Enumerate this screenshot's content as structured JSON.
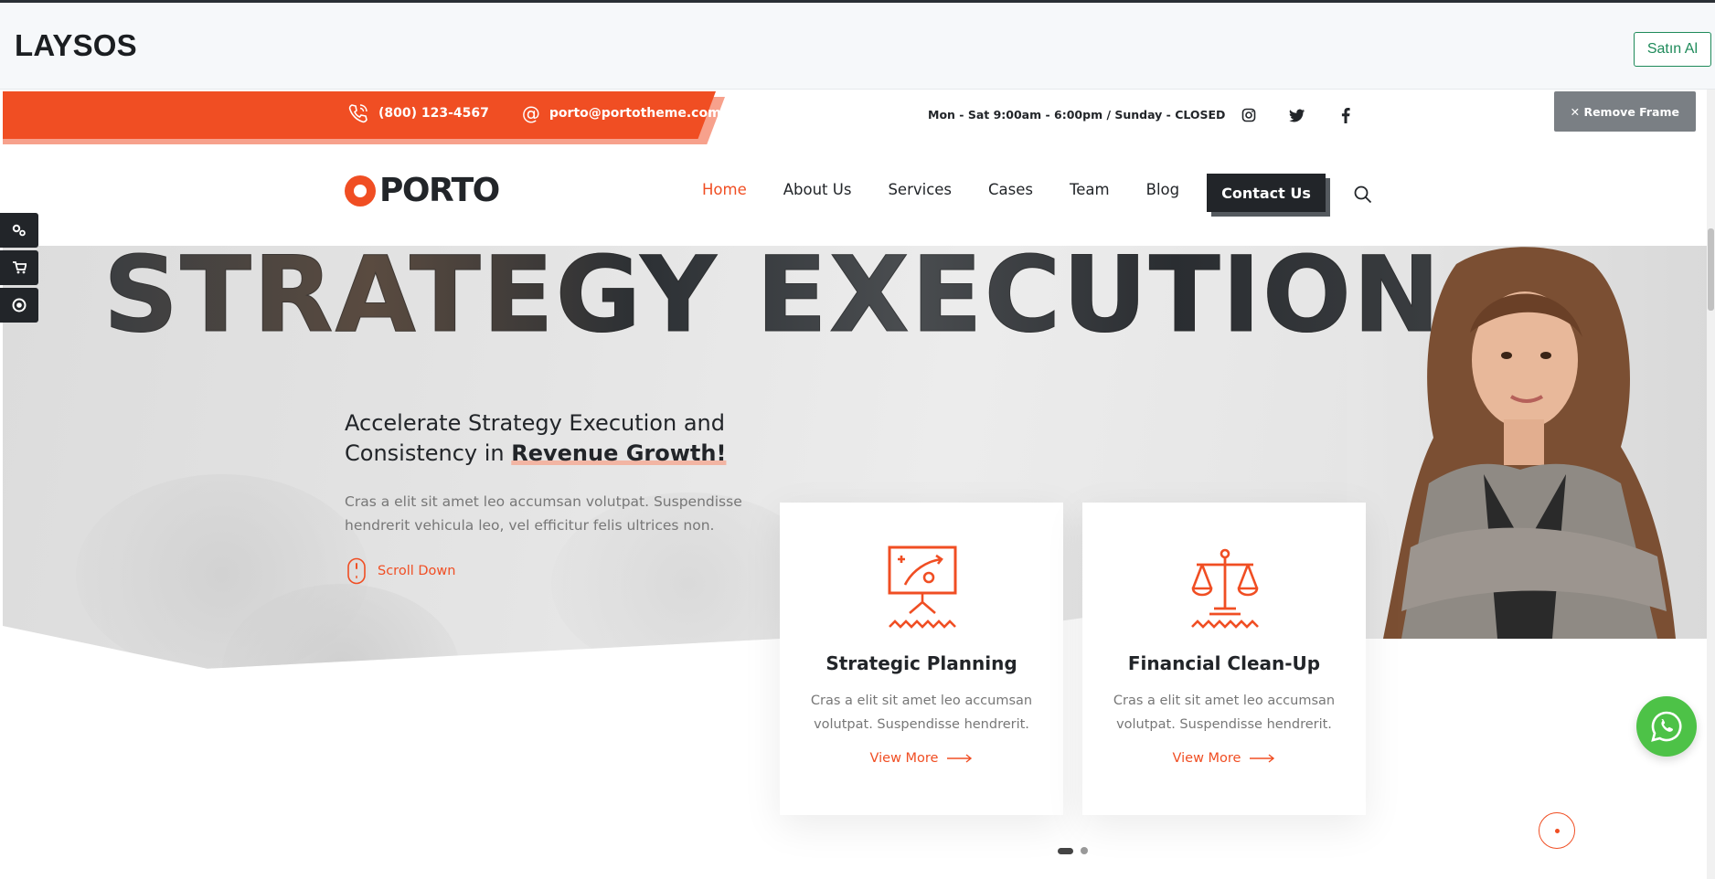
{
  "frame": {
    "title": "LAYSOS",
    "buy_label": "Satın Al",
    "remove_frame_label": "✕ Remove Frame"
  },
  "topbar": {
    "phone": "(800) 123-4567",
    "email": "porto@portotheme.com",
    "hours": "Mon - Sat 9:00am - 6:00pm / Sunday - CLOSED",
    "socials": [
      "instagram-icon",
      "twitter-icon",
      "facebook-icon"
    ]
  },
  "header": {
    "logo_text": "PORTO",
    "nav": [
      "Home",
      "About Us",
      "Services",
      "Cases",
      "Team",
      "Blog"
    ],
    "active_nav": "Home",
    "contact_label": "Contact Us"
  },
  "hero": {
    "big_title": "STRATEGY EXECUTION",
    "headline_part1": "Accelerate Strategy Execution and Consistency in ",
    "headline_highlight": "Revenue Growth!",
    "description": "Cras a elit sit amet leo accumsan volutpat. Suspendisse hendrerit vehicula leo, vel efficitur felis ultrices non.",
    "scroll_label": "Scroll Down"
  },
  "cards": [
    {
      "title": "Strategic Planning",
      "text": "Cras a elit sit amet leo accumsan volutpat. Suspendisse hendrerit.",
      "link": "View More",
      "icon": "strategy-board-icon"
    },
    {
      "title": "Financial Clean-Up",
      "text": "Cras a elit sit amet leo accumsan volutpat. Suspendisse hendrerit.",
      "link": "View More",
      "icon": "scales-icon"
    }
  ],
  "colors": {
    "accent": "#f04e23",
    "dark": "#222529",
    "whatsapp": "#4dc247"
  }
}
